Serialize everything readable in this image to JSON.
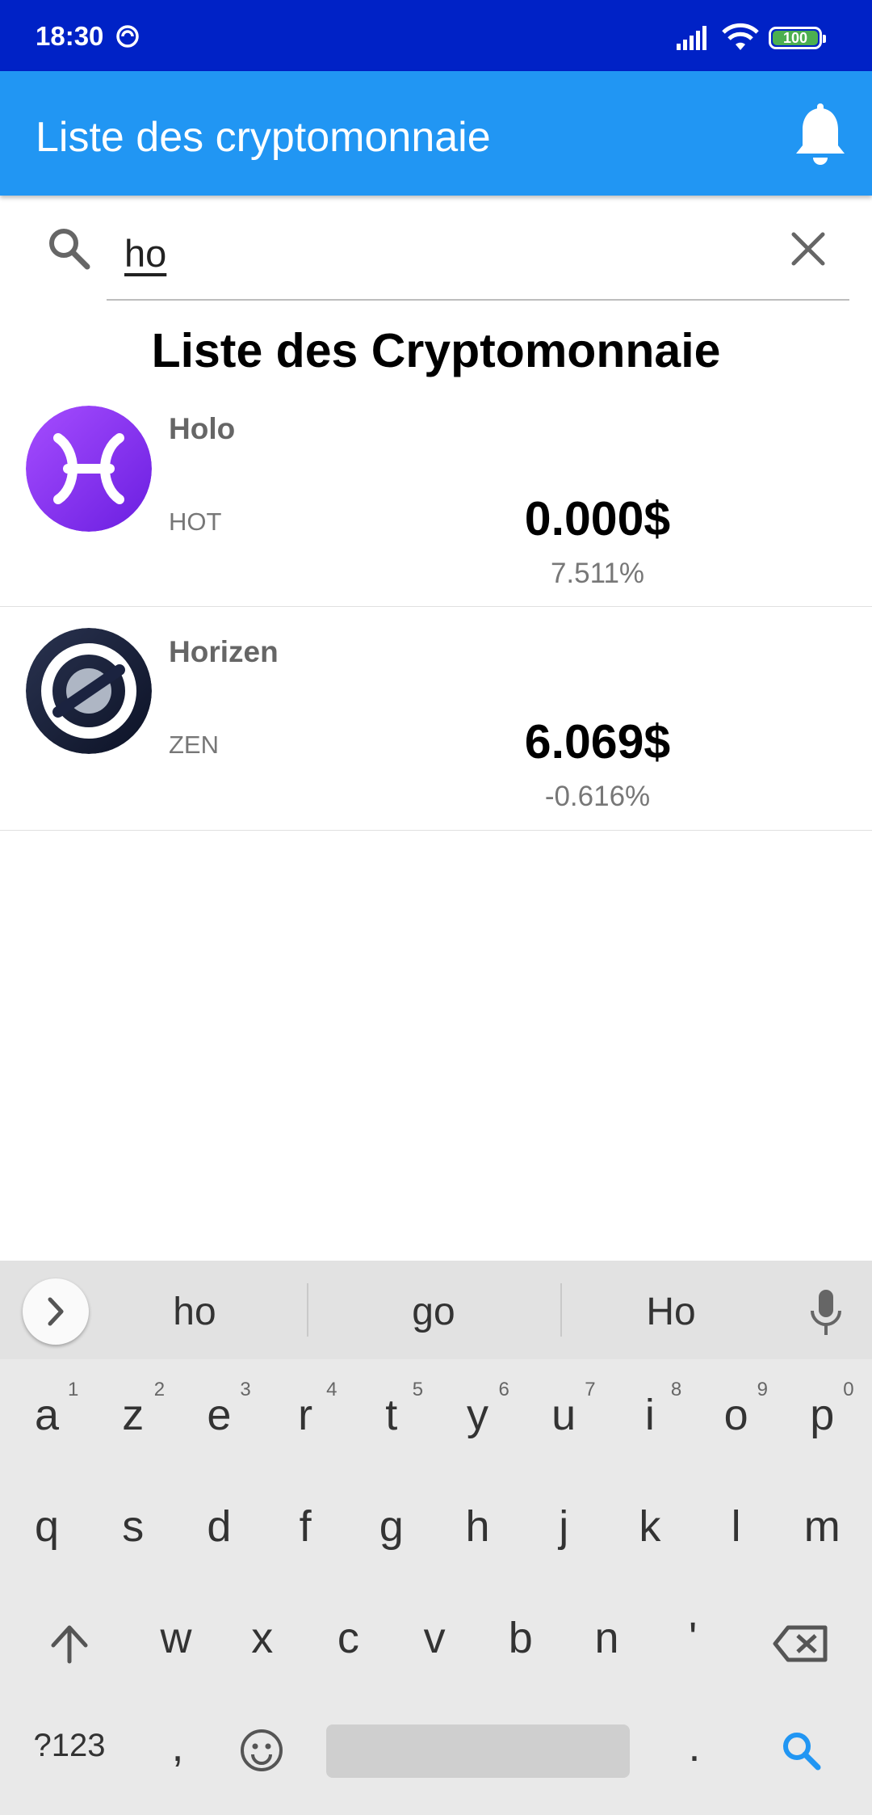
{
  "status_bar": {
    "time": "18:30",
    "battery": "100"
  },
  "app_bar": {
    "title": "Liste des cryptomonnaie"
  },
  "search": {
    "query": "ho"
  },
  "list": {
    "heading": "Liste des Cryptomonnaie",
    "items": [
      {
        "name": "Holo",
        "symbol": "HOT",
        "price": "0.000$",
        "change": "7.511%",
        "logo": "holo-logo-icon"
      },
      {
        "name": "Horizen",
        "symbol": "ZEN",
        "price": "6.069$",
        "change": "-0.616%",
        "logo": "horizen-logo-icon"
      }
    ]
  },
  "keyboard": {
    "suggestions": [
      "ho",
      "go",
      "Ho"
    ],
    "row1": [
      "a",
      "z",
      "e",
      "r",
      "t",
      "y",
      "u",
      "i",
      "o",
      "p"
    ],
    "row1_hints": [
      "1",
      "2",
      "3",
      "4",
      "5",
      "6",
      "7",
      "8",
      "9",
      "0"
    ],
    "row2": [
      "q",
      "s",
      "d",
      "f",
      "g",
      "h",
      "j",
      "k",
      "l",
      "m"
    ],
    "row3": [
      "w",
      "x",
      "c",
      "v",
      "b",
      "n",
      "'"
    ],
    "symbols_key": "?123",
    "comma_key": ",",
    "period_key": "."
  },
  "colors": {
    "status_bar": "#0022c6",
    "app_bar": "#2196f3",
    "accent": "#2196f3"
  }
}
